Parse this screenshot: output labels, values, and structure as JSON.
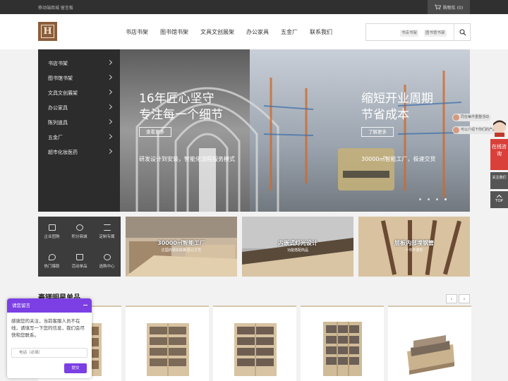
{
  "topbar": {
    "left_text": "移动端商城 留言板",
    "cart_label": "购物车 (0)"
  },
  "nav": [
    "书店书架",
    "图书馆书架",
    "文具文创展架",
    "办公家具",
    "五金厂",
    "联系我们"
  ],
  "search": {
    "placeholder": "",
    "chips": [
      "书店书架",
      "图书馆书架"
    ]
  },
  "sidebar": [
    "书店书架",
    "图书馆书架",
    "文具文创展架",
    "办公家具",
    "陈列道具",
    "五金厂",
    "超市化妆医药"
  ],
  "banner": {
    "left_title1": "16年匠心坚守",
    "left_title2": "专注每一个细节",
    "left_btn": "查看更多",
    "left_sub": "研发设计到安装，智能化流程服务模式",
    "right_title1": "缩短开业周期",
    "right_title2": "节省成本",
    "right_btn": "了解更多",
    "right_sub": "30000㎡智能工厂，极速交货"
  },
  "quick": [
    "企业团购",
    "积分商城",
    "定制专属",
    "热门爆款",
    "活动单品",
    "选购中心"
  ],
  "promos": [
    {
      "title": "30000㎡智能工厂",
      "sub": "达国内领先标准·匠心工艺"
    },
    {
      "title": "内嵌式灯光设计",
      "sub": "功能搭配商品"
    },
    {
      "title": "层板内部埋钢管",
      "sub": "十年不变形"
    }
  ],
  "section": {
    "title": "豪镁明星单品",
    "prev": "‹",
    "next": "›"
  },
  "chat": {
    "title": "请您留言",
    "body": "感谢您的关注，当前客服人员不在线，请填写一下您的信息，我们会尽快和您联系。",
    "phone_placeholder": "电话（必填）",
    "submit": "提交"
  },
  "float": {
    "bubble1": "同在每件重整活动",
    "bubble2": "可以介绍下你们的产品么",
    "consult": "在线咨询",
    "qr": "关注我们",
    "top": "TOP"
  },
  "colors": {
    "accent": "#7b3fe4",
    "logo": "#8a5d3b",
    "dark": "#2c2c2c"
  }
}
